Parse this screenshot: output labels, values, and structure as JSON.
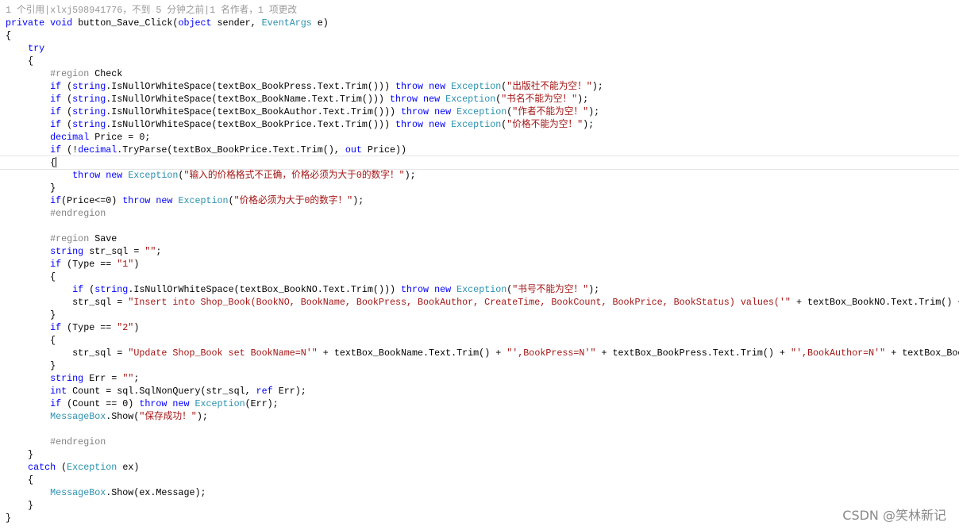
{
  "codelens": "1 个引用|xlxj598941776，不到 5 分钟之前|1 名作者，1 项更改",
  "watermark": "CSDN @笑林新记",
  "colors": {
    "keyword": "#0000ff",
    "type": "#2b91af",
    "string": "#a31515",
    "region": "#808080"
  },
  "current_line": 12,
  "lines": [
    [
      [
        "k",
        "private void "
      ],
      [
        "p",
        "button_Save_Click("
      ],
      [
        "k",
        "object "
      ],
      [
        "p",
        "sender, "
      ],
      [
        "t",
        "EventArgs "
      ],
      [
        "p",
        "e)"
      ]
    ],
    [
      [
        "p",
        "{"
      ]
    ],
    [
      [
        "p",
        "    "
      ],
      [
        "k",
        "try"
      ]
    ],
    [
      [
        "p",
        "    {"
      ]
    ],
    [
      [
        "p",
        "        "
      ],
      [
        "r",
        "#region "
      ],
      [
        "p",
        "Check"
      ]
    ],
    [
      [
        "p",
        "        "
      ],
      [
        "k",
        "if "
      ],
      [
        "p",
        "("
      ],
      [
        "k",
        "string"
      ],
      [
        "p",
        ".IsNullOrWhiteSpace(textBox_BookPress.Text.Trim())) "
      ],
      [
        "k",
        "throw new "
      ],
      [
        "t",
        "Exception"
      ],
      [
        "p",
        "("
      ],
      [
        "s",
        "\"出版社不能为空！\""
      ],
      [
        "p",
        ");"
      ]
    ],
    [
      [
        "p",
        "        "
      ],
      [
        "k",
        "if "
      ],
      [
        "p",
        "("
      ],
      [
        "k",
        "string"
      ],
      [
        "p",
        ".IsNullOrWhiteSpace(textBox_BookName.Text.Trim())) "
      ],
      [
        "k",
        "throw new "
      ],
      [
        "t",
        "Exception"
      ],
      [
        "p",
        "("
      ],
      [
        "s",
        "\"书名不能为空！\""
      ],
      [
        "p",
        ");"
      ]
    ],
    [
      [
        "p",
        "        "
      ],
      [
        "k",
        "if "
      ],
      [
        "p",
        "("
      ],
      [
        "k",
        "string"
      ],
      [
        "p",
        ".IsNullOrWhiteSpace(textBox_BookAuthor.Text.Trim())) "
      ],
      [
        "k",
        "throw new "
      ],
      [
        "t",
        "Exception"
      ],
      [
        "p",
        "("
      ],
      [
        "s",
        "\"作者不能为空！\""
      ],
      [
        "p",
        ");"
      ]
    ],
    [
      [
        "p",
        "        "
      ],
      [
        "k",
        "if "
      ],
      [
        "p",
        "("
      ],
      [
        "k",
        "string"
      ],
      [
        "p",
        ".IsNullOrWhiteSpace(textBox_BookPrice.Text.Trim())) "
      ],
      [
        "k",
        "throw new "
      ],
      [
        "t",
        "Exception"
      ],
      [
        "p",
        "("
      ],
      [
        "s",
        "\"价格不能为空！\""
      ],
      [
        "p",
        ");"
      ]
    ],
    [
      [
        "p",
        "        "
      ],
      [
        "k",
        "decimal "
      ],
      [
        "p",
        "Price = 0;"
      ]
    ],
    [
      [
        "p",
        "        "
      ],
      [
        "k",
        "if "
      ],
      [
        "p",
        "(!"
      ],
      [
        "k",
        "decimal"
      ],
      [
        "p",
        ".TryParse(textBox_BookPrice.Text.Trim(), "
      ],
      [
        "k",
        "out "
      ],
      [
        "p",
        "Price))"
      ]
    ],
    [
      [
        "p",
        "        {"
      ]
    ],
    [
      [
        "p",
        "            "
      ],
      [
        "k",
        "throw new "
      ],
      [
        "t",
        "Exception"
      ],
      [
        "p",
        "("
      ],
      [
        "s",
        "\"输入的价格格式不正确，价格必须为大于0的数字！\""
      ],
      [
        "p",
        ");"
      ]
    ],
    [
      [
        "p",
        "        }"
      ]
    ],
    [
      [
        "p",
        "        "
      ],
      [
        "k",
        "if"
      ],
      [
        "p",
        "(Price<=0) "
      ],
      [
        "k",
        "throw new "
      ],
      [
        "t",
        "Exception"
      ],
      [
        "p",
        "("
      ],
      [
        "s",
        "\"价格必须为大于0的数字！\""
      ],
      [
        "p",
        ");"
      ]
    ],
    [
      [
        "p",
        "        "
      ],
      [
        "r",
        "#endregion"
      ]
    ],
    [],
    [
      [
        "p",
        "        "
      ],
      [
        "r",
        "#region "
      ],
      [
        "p",
        "Save"
      ]
    ],
    [
      [
        "p",
        "        "
      ],
      [
        "k",
        "string "
      ],
      [
        "p",
        "str_sql = "
      ],
      [
        "s",
        "\"\""
      ],
      [
        "p",
        ";"
      ]
    ],
    [
      [
        "p",
        "        "
      ],
      [
        "k",
        "if "
      ],
      [
        "p",
        "(Type == "
      ],
      [
        "s",
        "\"1\""
      ],
      [
        "p",
        ")"
      ]
    ],
    [
      [
        "p",
        "        {"
      ]
    ],
    [
      [
        "p",
        "            "
      ],
      [
        "k",
        "if "
      ],
      [
        "p",
        "("
      ],
      [
        "k",
        "string"
      ],
      [
        "p",
        ".IsNullOrWhiteSpace(textBox_BookNO.Text.Trim())) "
      ],
      [
        "k",
        "throw new "
      ],
      [
        "t",
        "Exception"
      ],
      [
        "p",
        "("
      ],
      [
        "s",
        "\"书号不能为空！\""
      ],
      [
        "p",
        ");"
      ]
    ],
    [
      [
        "p",
        "            str_sql = "
      ],
      [
        "s",
        "\"Insert into Shop_Book(BookNO, BookName, BookPress, BookAuthor, CreateTime, BookCount, BookPrice, BookStatus) values('\""
      ],
      [
        "p",
        " + textBox_BookNO.Text.Trim() + "
      ]
    ],
    [
      [
        "p",
        "        }"
      ]
    ],
    [
      [
        "p",
        "        "
      ],
      [
        "k",
        "if "
      ],
      [
        "p",
        "(Type == "
      ],
      [
        "s",
        "\"2\""
      ],
      [
        "p",
        ")"
      ]
    ],
    [
      [
        "p",
        "        {"
      ]
    ],
    [
      [
        "p",
        "            str_sql = "
      ],
      [
        "s",
        "\"Update Shop_Book set BookName=N'\""
      ],
      [
        "p",
        " + textBox_BookName.Text.Trim() + "
      ],
      [
        "s",
        "\"',BookPress=N'\""
      ],
      [
        "p",
        " + textBox_BookPress.Text.Trim() + "
      ],
      [
        "s",
        "\"',BookAuthor=N'\""
      ],
      [
        "p",
        " + textBox_BookAuthor"
      ]
    ],
    [
      [
        "p",
        "        }"
      ]
    ],
    [
      [
        "p",
        "        "
      ],
      [
        "k",
        "string "
      ],
      [
        "p",
        "Err = "
      ],
      [
        "s",
        "\"\""
      ],
      [
        "p",
        ";"
      ]
    ],
    [
      [
        "p",
        "        "
      ],
      [
        "k",
        "int "
      ],
      [
        "p",
        "Count = sql.SqlNonQuery(str_sql, "
      ],
      [
        "k",
        "ref "
      ],
      [
        "p",
        "Err);"
      ]
    ],
    [
      [
        "p",
        "        "
      ],
      [
        "k",
        "if "
      ],
      [
        "p",
        "(Count == 0) "
      ],
      [
        "k",
        "throw new "
      ],
      [
        "t",
        "Exception"
      ],
      [
        "p",
        "(Err);"
      ]
    ],
    [
      [
        "p",
        "        "
      ],
      [
        "t",
        "MessageBox"
      ],
      [
        "p",
        ".Show("
      ],
      [
        "s",
        "\"保存成功！\""
      ],
      [
        "p",
        ");"
      ]
    ],
    [],
    [
      [
        "p",
        "        "
      ],
      [
        "r",
        "#endregion"
      ]
    ],
    [
      [
        "p",
        "    }"
      ]
    ],
    [
      [
        "p",
        "    "
      ],
      [
        "k",
        "catch "
      ],
      [
        "p",
        "("
      ],
      [
        "t",
        "Exception "
      ],
      [
        "p",
        "ex)"
      ]
    ],
    [
      [
        "p",
        "    {"
      ]
    ],
    [
      [
        "p",
        "        "
      ],
      [
        "t",
        "MessageBox"
      ],
      [
        "p",
        ".Show(ex.Message);"
      ]
    ],
    [
      [
        "p",
        "    }"
      ]
    ],
    [
      [
        "p",
        "}"
      ]
    ]
  ]
}
